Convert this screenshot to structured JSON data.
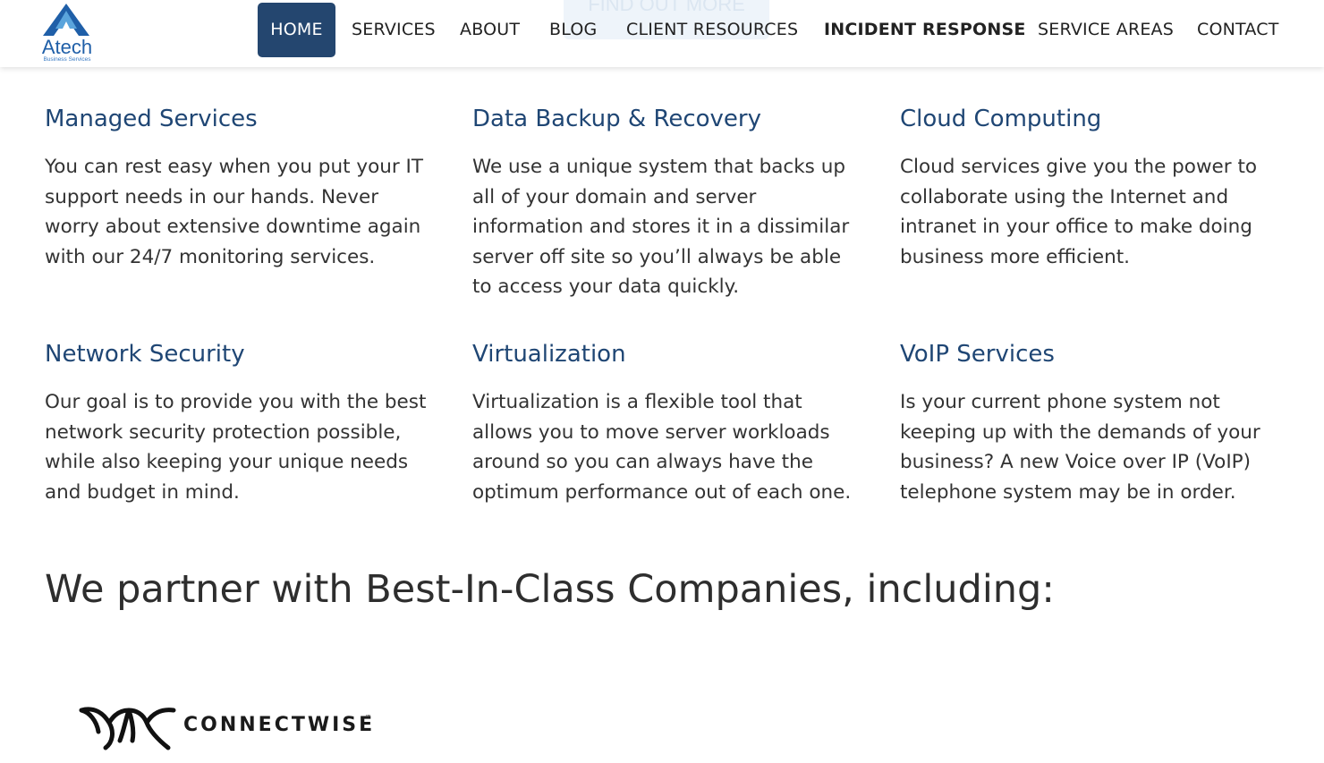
{
  "header": {
    "ghost_button_label": "FIND OUT MORE",
    "logo": {
      "name": "Atech",
      "subtitle": "Business Services",
      "colors": {
        "primary": "#1f5fa8",
        "accent": "#5aa4dc"
      }
    },
    "nav": [
      {
        "label": "HOME",
        "active": true
      },
      {
        "label": "SERVICES",
        "active": false
      },
      {
        "label": "ABOUT",
        "active": false
      },
      {
        "label": "BLOG",
        "active": false
      },
      {
        "label": "CLIENT RESOURCES",
        "active": false
      },
      {
        "label": "INCIDENT RESPONSE",
        "active": false,
        "bold": true
      },
      {
        "label": "SERVICE AREAS",
        "active": false
      },
      {
        "label": "CONTACT",
        "active": false
      }
    ],
    "active_color": "#24466f"
  },
  "services": [
    {
      "title": "Managed Services",
      "lines": [
        "You can rest easy when you put your IT",
        "support needs in our hands. Never",
        "worry about extensive downtime again",
        "with our 24/7 monitoring services."
      ]
    },
    {
      "title": "Data Backup & Recovery",
      "lines": [
        "We use a unique system that backs up",
        "all of your domain and server",
        "information and stores it in a dissimilar",
        "server off site so you’ll always be able",
        "to access your data quickly."
      ]
    },
    {
      "title": "Cloud Computing",
      "lines": [
        "Cloud services give you the power to",
        "collaborate using the Internet and",
        "intranet in your office to make doing",
        "business more efficient."
      ]
    },
    {
      "title": "Network Security",
      "lines": [
        "Our goal is to provide you with the best",
        "network security protection possible,",
        "while also keeping your unique needs",
        "and budget in mind."
      ]
    },
    {
      "title": "Virtualization",
      "lines": [
        "Virtualization is a flexible tool that",
        "allows you to move server workloads",
        "around so you can always have the",
        "optimum performance out of each one."
      ]
    },
    {
      "title": "VoIP Services",
      "lines": [
        "Is your current phone system not",
        "keeping up with the demands of your",
        "business? A new Voice over IP (VoIP)",
        "telephone system may be in order."
      ]
    }
  ],
  "title_color": "#1f4674",
  "partners": {
    "heading": "We partner with Best-In-Class Companies, including:",
    "logos": [
      {
        "name": "CONNECTWISE",
        "trademark": "™",
        "icon": "connectwise-logo-icon"
      }
    ]
  }
}
